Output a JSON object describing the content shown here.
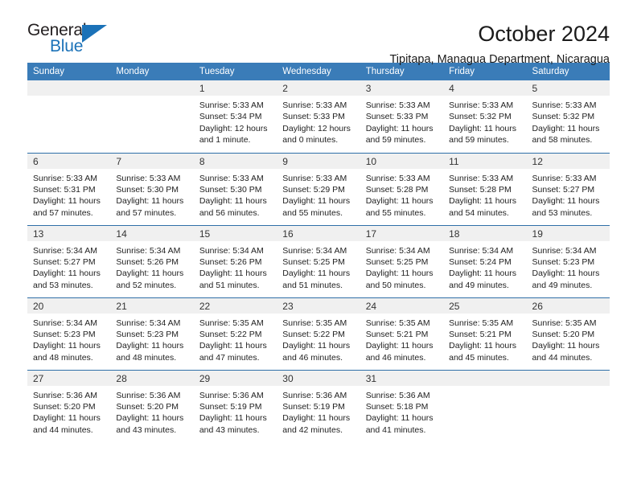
{
  "logo": {
    "word_top": "General",
    "word_bottom": "Blue",
    "accent_color": "#1b72b8"
  },
  "header": {
    "title": "October 2024",
    "subtitle": "Tipitapa, Managua Department, Nicaragua"
  },
  "theme": {
    "header_row_bg": "#3a7cb8",
    "divider": "#2f6fa8",
    "daynum_bg": "#f0f0f0"
  },
  "weekday_headers": [
    "Sunday",
    "Monday",
    "Tuesday",
    "Wednesday",
    "Thursday",
    "Friday",
    "Saturday"
  ],
  "labels": {
    "sunrise_prefix": "Sunrise:",
    "sunset_prefix": "Sunset:",
    "daylight_prefix": "Daylight:"
  },
  "weeks": [
    [
      {
        "day": "",
        "empty": true
      },
      {
        "day": "",
        "empty": true
      },
      {
        "day": "1",
        "sunrise": "Sunrise: 5:33 AM",
        "sunset": "Sunset: 5:34 PM",
        "daylight_a": "Daylight: 12 hours",
        "daylight_b": "and 1 minute."
      },
      {
        "day": "2",
        "sunrise": "Sunrise: 5:33 AM",
        "sunset": "Sunset: 5:33 PM",
        "daylight_a": "Daylight: 12 hours",
        "daylight_b": "and 0 minutes."
      },
      {
        "day": "3",
        "sunrise": "Sunrise: 5:33 AM",
        "sunset": "Sunset: 5:33 PM",
        "daylight_a": "Daylight: 11 hours",
        "daylight_b": "and 59 minutes."
      },
      {
        "day": "4",
        "sunrise": "Sunrise: 5:33 AM",
        "sunset": "Sunset: 5:32 PM",
        "daylight_a": "Daylight: 11 hours",
        "daylight_b": "and 59 minutes."
      },
      {
        "day": "5",
        "sunrise": "Sunrise: 5:33 AM",
        "sunset": "Sunset: 5:32 PM",
        "daylight_a": "Daylight: 11 hours",
        "daylight_b": "and 58 minutes."
      }
    ],
    [
      {
        "day": "6",
        "sunrise": "Sunrise: 5:33 AM",
        "sunset": "Sunset: 5:31 PM",
        "daylight_a": "Daylight: 11 hours",
        "daylight_b": "and 57 minutes."
      },
      {
        "day": "7",
        "sunrise": "Sunrise: 5:33 AM",
        "sunset": "Sunset: 5:30 PM",
        "daylight_a": "Daylight: 11 hours",
        "daylight_b": "and 57 minutes."
      },
      {
        "day": "8",
        "sunrise": "Sunrise: 5:33 AM",
        "sunset": "Sunset: 5:30 PM",
        "daylight_a": "Daylight: 11 hours",
        "daylight_b": "and 56 minutes."
      },
      {
        "day": "9",
        "sunrise": "Sunrise: 5:33 AM",
        "sunset": "Sunset: 5:29 PM",
        "daylight_a": "Daylight: 11 hours",
        "daylight_b": "and 55 minutes."
      },
      {
        "day": "10",
        "sunrise": "Sunrise: 5:33 AM",
        "sunset": "Sunset: 5:28 PM",
        "daylight_a": "Daylight: 11 hours",
        "daylight_b": "and 55 minutes."
      },
      {
        "day": "11",
        "sunrise": "Sunrise: 5:33 AM",
        "sunset": "Sunset: 5:28 PM",
        "daylight_a": "Daylight: 11 hours",
        "daylight_b": "and 54 minutes."
      },
      {
        "day": "12",
        "sunrise": "Sunrise: 5:33 AM",
        "sunset": "Sunset: 5:27 PM",
        "daylight_a": "Daylight: 11 hours",
        "daylight_b": "and 53 minutes."
      }
    ],
    [
      {
        "day": "13",
        "sunrise": "Sunrise: 5:34 AM",
        "sunset": "Sunset: 5:27 PM",
        "daylight_a": "Daylight: 11 hours",
        "daylight_b": "and 53 minutes."
      },
      {
        "day": "14",
        "sunrise": "Sunrise: 5:34 AM",
        "sunset": "Sunset: 5:26 PM",
        "daylight_a": "Daylight: 11 hours",
        "daylight_b": "and 52 minutes."
      },
      {
        "day": "15",
        "sunrise": "Sunrise: 5:34 AM",
        "sunset": "Sunset: 5:26 PM",
        "daylight_a": "Daylight: 11 hours",
        "daylight_b": "and 51 minutes."
      },
      {
        "day": "16",
        "sunrise": "Sunrise: 5:34 AM",
        "sunset": "Sunset: 5:25 PM",
        "daylight_a": "Daylight: 11 hours",
        "daylight_b": "and 51 minutes."
      },
      {
        "day": "17",
        "sunrise": "Sunrise: 5:34 AM",
        "sunset": "Sunset: 5:25 PM",
        "daylight_a": "Daylight: 11 hours",
        "daylight_b": "and 50 minutes."
      },
      {
        "day": "18",
        "sunrise": "Sunrise: 5:34 AM",
        "sunset": "Sunset: 5:24 PM",
        "daylight_a": "Daylight: 11 hours",
        "daylight_b": "and 49 minutes."
      },
      {
        "day": "19",
        "sunrise": "Sunrise: 5:34 AM",
        "sunset": "Sunset: 5:23 PM",
        "daylight_a": "Daylight: 11 hours",
        "daylight_b": "and 49 minutes."
      }
    ],
    [
      {
        "day": "20",
        "sunrise": "Sunrise: 5:34 AM",
        "sunset": "Sunset: 5:23 PM",
        "daylight_a": "Daylight: 11 hours",
        "daylight_b": "and 48 minutes."
      },
      {
        "day": "21",
        "sunrise": "Sunrise: 5:34 AM",
        "sunset": "Sunset: 5:23 PM",
        "daylight_a": "Daylight: 11 hours",
        "daylight_b": "and 48 minutes."
      },
      {
        "day": "22",
        "sunrise": "Sunrise: 5:35 AM",
        "sunset": "Sunset: 5:22 PM",
        "daylight_a": "Daylight: 11 hours",
        "daylight_b": "and 47 minutes."
      },
      {
        "day": "23",
        "sunrise": "Sunrise: 5:35 AM",
        "sunset": "Sunset: 5:22 PM",
        "daylight_a": "Daylight: 11 hours",
        "daylight_b": "and 46 minutes."
      },
      {
        "day": "24",
        "sunrise": "Sunrise: 5:35 AM",
        "sunset": "Sunset: 5:21 PM",
        "daylight_a": "Daylight: 11 hours",
        "daylight_b": "and 46 minutes."
      },
      {
        "day": "25",
        "sunrise": "Sunrise: 5:35 AM",
        "sunset": "Sunset: 5:21 PM",
        "daylight_a": "Daylight: 11 hours",
        "daylight_b": "and 45 minutes."
      },
      {
        "day": "26",
        "sunrise": "Sunrise: 5:35 AM",
        "sunset": "Sunset: 5:20 PM",
        "daylight_a": "Daylight: 11 hours",
        "daylight_b": "and 44 minutes."
      }
    ],
    [
      {
        "day": "27",
        "sunrise": "Sunrise: 5:36 AM",
        "sunset": "Sunset: 5:20 PM",
        "daylight_a": "Daylight: 11 hours",
        "daylight_b": "and 44 minutes."
      },
      {
        "day": "28",
        "sunrise": "Sunrise: 5:36 AM",
        "sunset": "Sunset: 5:20 PM",
        "daylight_a": "Daylight: 11 hours",
        "daylight_b": "and 43 minutes."
      },
      {
        "day": "29",
        "sunrise": "Sunrise: 5:36 AM",
        "sunset": "Sunset: 5:19 PM",
        "daylight_a": "Daylight: 11 hours",
        "daylight_b": "and 43 minutes."
      },
      {
        "day": "30",
        "sunrise": "Sunrise: 5:36 AM",
        "sunset": "Sunset: 5:19 PM",
        "daylight_a": "Daylight: 11 hours",
        "daylight_b": "and 42 minutes."
      },
      {
        "day": "31",
        "sunrise": "Sunrise: 5:36 AM",
        "sunset": "Sunset: 5:18 PM",
        "daylight_a": "Daylight: 11 hours",
        "daylight_b": "and 41 minutes."
      },
      {
        "day": "",
        "empty": true
      },
      {
        "day": "",
        "empty": true
      }
    ]
  ]
}
